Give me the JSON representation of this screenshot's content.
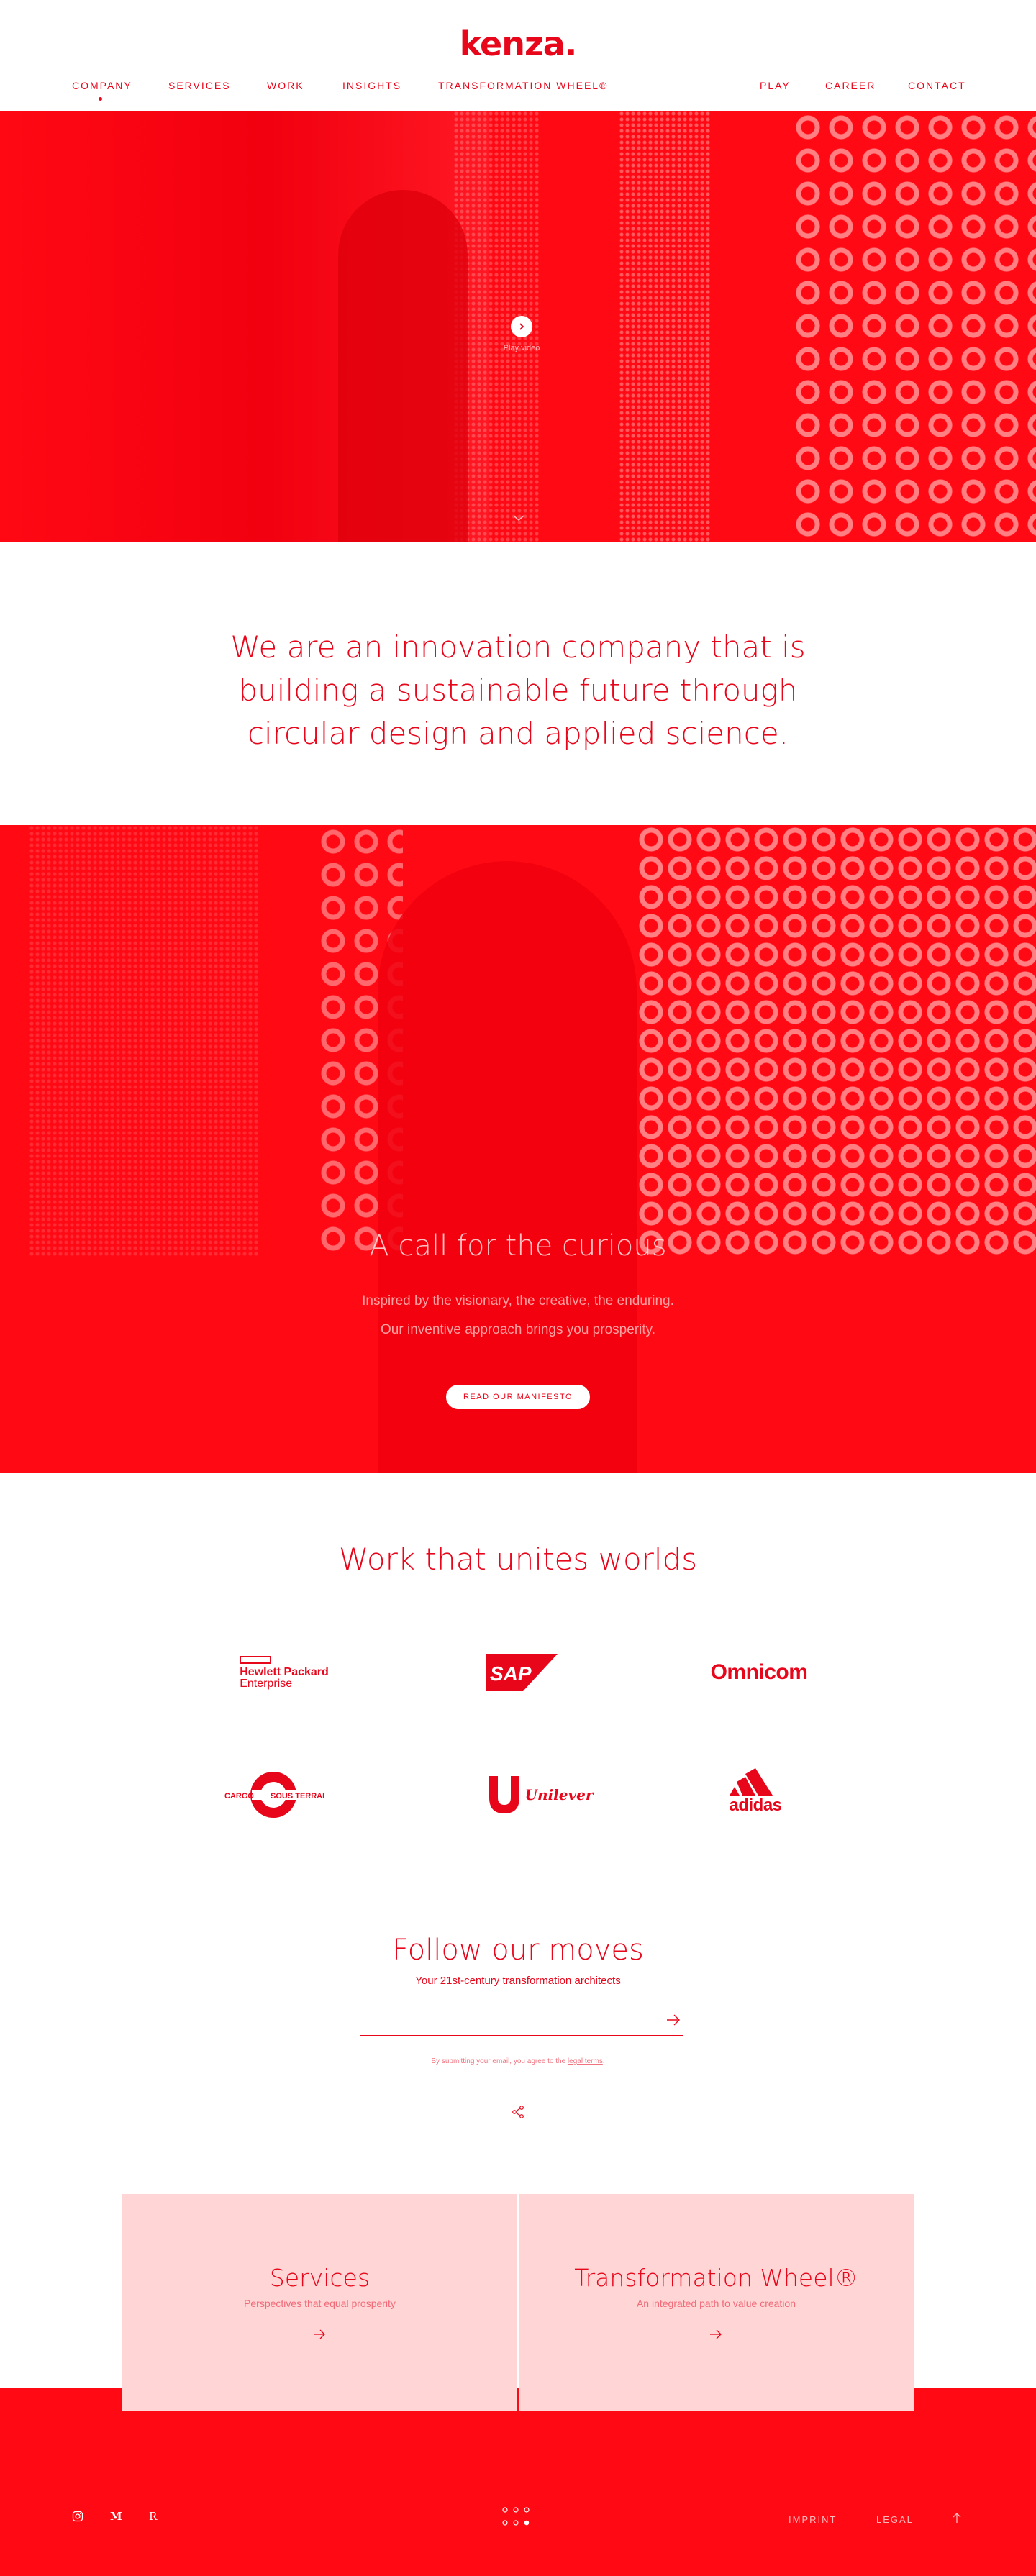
{
  "brand": {
    "logo": "kenza.",
    "accent": "#e8061b",
    "hero_red": "#ff0a14",
    "card_pink": "#ffd5d5"
  },
  "nav": {
    "left": [
      {
        "label": "COMPANY",
        "active": true
      },
      {
        "label": "SERVICES"
      },
      {
        "label": "WORK"
      },
      {
        "label": "INSIGHTS"
      },
      {
        "label": "TRANSFORMATION WHEEL®"
      }
    ],
    "right": [
      {
        "label": "PLAY"
      },
      {
        "label": "CAREER"
      },
      {
        "label": "CONTACT"
      }
    ]
  },
  "hero": {
    "play_label": "Play video",
    "play_icon": "chevron-right-icon",
    "scroll_icon": "chevron-down-icon"
  },
  "mission": {
    "lines": [
      "We are an innovation company that is",
      "building a sustainable future through",
      "circular design and applied science."
    ]
  },
  "manifesto": {
    "title": "A call for the curious",
    "body": [
      "Inspired by the visionary, the creative, the enduring.",
      "Our inventive approach brings you prosperity."
    ],
    "button": "READ OUR MANIFESTO"
  },
  "clients": {
    "title": "Work that unites worlds",
    "logos": [
      {
        "name": "Hewlett Packard Enterprise",
        "line1": "Hewlett Packard",
        "line2": "Enterprise"
      },
      {
        "name": "SAP",
        "text": "SAP"
      },
      {
        "name": "Omnicom",
        "text": "Omnicom"
      },
      {
        "name": "Cargo Sous Terrain",
        "left": "CARGO",
        "right": "SOUS TERRAIN"
      },
      {
        "name": "Unilever",
        "text": "Unilever"
      },
      {
        "name": "adidas",
        "text": "adidas"
      }
    ]
  },
  "newsletter": {
    "title": "Follow our moves",
    "subtitle": "Your 21st-century transformation architects",
    "email_value": "",
    "legal_prefix": "By submitting your email, you agree to the",
    "legal_link": "legal terms",
    "legal_suffix": "."
  },
  "cards": [
    {
      "title": "Services",
      "subtitle": "Perspectives that equal prosperity"
    },
    {
      "title": "Transformation Wheel®",
      "subtitle": "An integrated path to value creation"
    }
  ],
  "footer": {
    "social": [
      {
        "icon": "instagram-icon"
      },
      {
        "icon": "medium-icon",
        "text": "M"
      },
      {
        "icon": "r-icon",
        "text": "R"
      }
    ],
    "links": [
      "IMPRINT",
      "LEGAL"
    ],
    "back_to_top_icon": "arrow-up-icon"
  }
}
